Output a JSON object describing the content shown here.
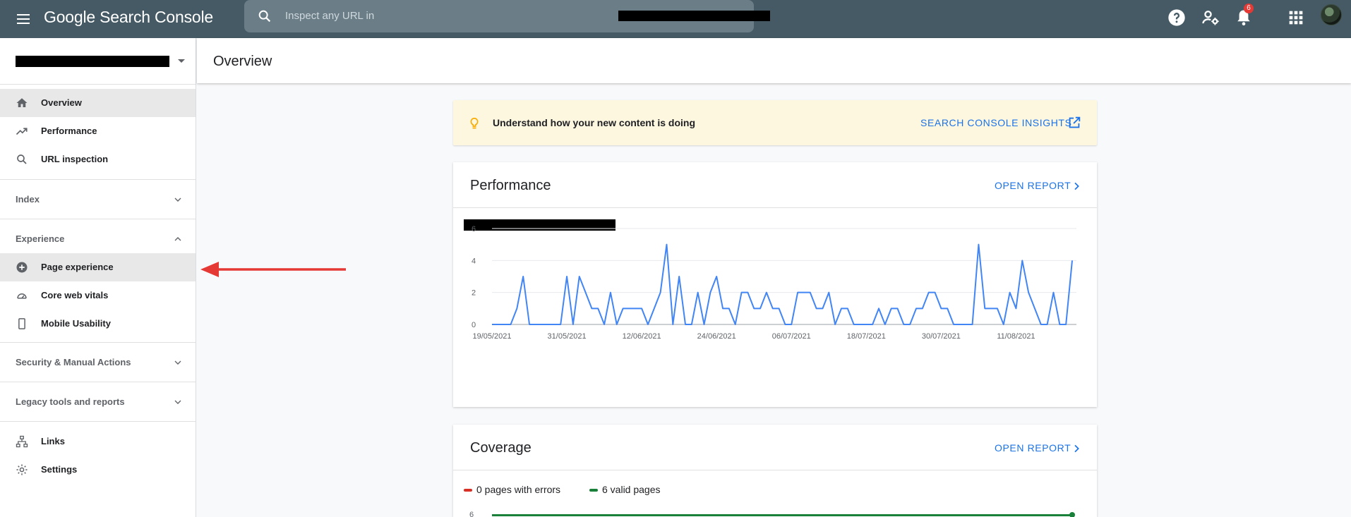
{
  "app": {
    "name": "Google Search Console"
  },
  "search": {
    "placeholder": "Inspect any URL in"
  },
  "topbar": {
    "notifications_count": "6"
  },
  "sidebar": {
    "items": [
      {
        "label": "Overview",
        "icon": "home-icon"
      },
      {
        "label": "Performance",
        "icon": "trending-up-icon"
      },
      {
        "label": "URL inspection",
        "icon": "search-icon"
      }
    ],
    "sections": [
      {
        "label": "Index"
      },
      {
        "label": "Experience"
      },
      {
        "label": "Security & Manual Actions"
      },
      {
        "label": "Legacy tools and reports"
      }
    ],
    "experience_items": [
      {
        "label": "Page experience",
        "icon": "add-circle-icon"
      },
      {
        "label": "Core web vitals",
        "icon": "speedometer-icon"
      },
      {
        "label": "Mobile Usability",
        "icon": "smartphone-icon"
      }
    ],
    "bottom_items": [
      {
        "label": "Links",
        "icon": "sitemap-icon"
      },
      {
        "label": "Settings",
        "icon": "gear-icon"
      }
    ]
  },
  "header": {
    "title": "Overview"
  },
  "insight": {
    "text": "Understand how your new content is doing",
    "link": "SEARCH CONSOLE INSIGHTS"
  },
  "performance": {
    "title": "Performance",
    "open_report": "OPEN REPORT"
  },
  "coverage": {
    "title": "Coverage",
    "open_report": "OPEN REPORT",
    "legend": [
      {
        "label": "0 pages with errors",
        "color": "#d93025"
      },
      {
        "label": "6 valid pages",
        "color": "#188038"
      }
    ],
    "y_top_tick": "6"
  },
  "colors": {
    "accent": "#1a73e8",
    "topbar": "#455a64",
    "line": "#4285f4",
    "annotation_arrow": "#e53935"
  },
  "chart_data": {
    "type": "line",
    "title": "",
    "xlabel": "",
    "ylabel": "",
    "x_ticks": [
      "19/05/2021",
      "31/05/2021",
      "12/06/2021",
      "24/06/2021",
      "06/07/2021",
      "18/07/2021",
      "30/07/2021",
      "11/08/2021"
    ],
    "x_start": "19/05/2021",
    "x_end": "20/08/2021",
    "y_ticks": [
      0,
      2,
      4,
      6
    ],
    "ylim": [
      0,
      6
    ],
    "grid": true,
    "series": [
      {
        "values": [
          0,
          0,
          0,
          0,
          1,
          3,
          0,
          0,
          0,
          0,
          0,
          0,
          3,
          0,
          3,
          2,
          1,
          1,
          0,
          2,
          0,
          1,
          1,
          1,
          1,
          0,
          1,
          2,
          5,
          0,
          3,
          0,
          0,
          2,
          0,
          2,
          3,
          1,
          1,
          0,
          2,
          2,
          1,
          1,
          2,
          1,
          1,
          0,
          0,
          2,
          2,
          2,
          1,
          1,
          2,
          0,
          1,
          1,
          0,
          0,
          0,
          0,
          1,
          0,
          1,
          1,
          0,
          0,
          1,
          1,
          2,
          2,
          1,
          1,
          0,
          0,
          0,
          0,
          5,
          1,
          1,
          1,
          0,
          2,
          1,
          4,
          2,
          1,
          0,
          0,
          2,
          0,
          0,
          4
        ]
      }
    ]
  }
}
